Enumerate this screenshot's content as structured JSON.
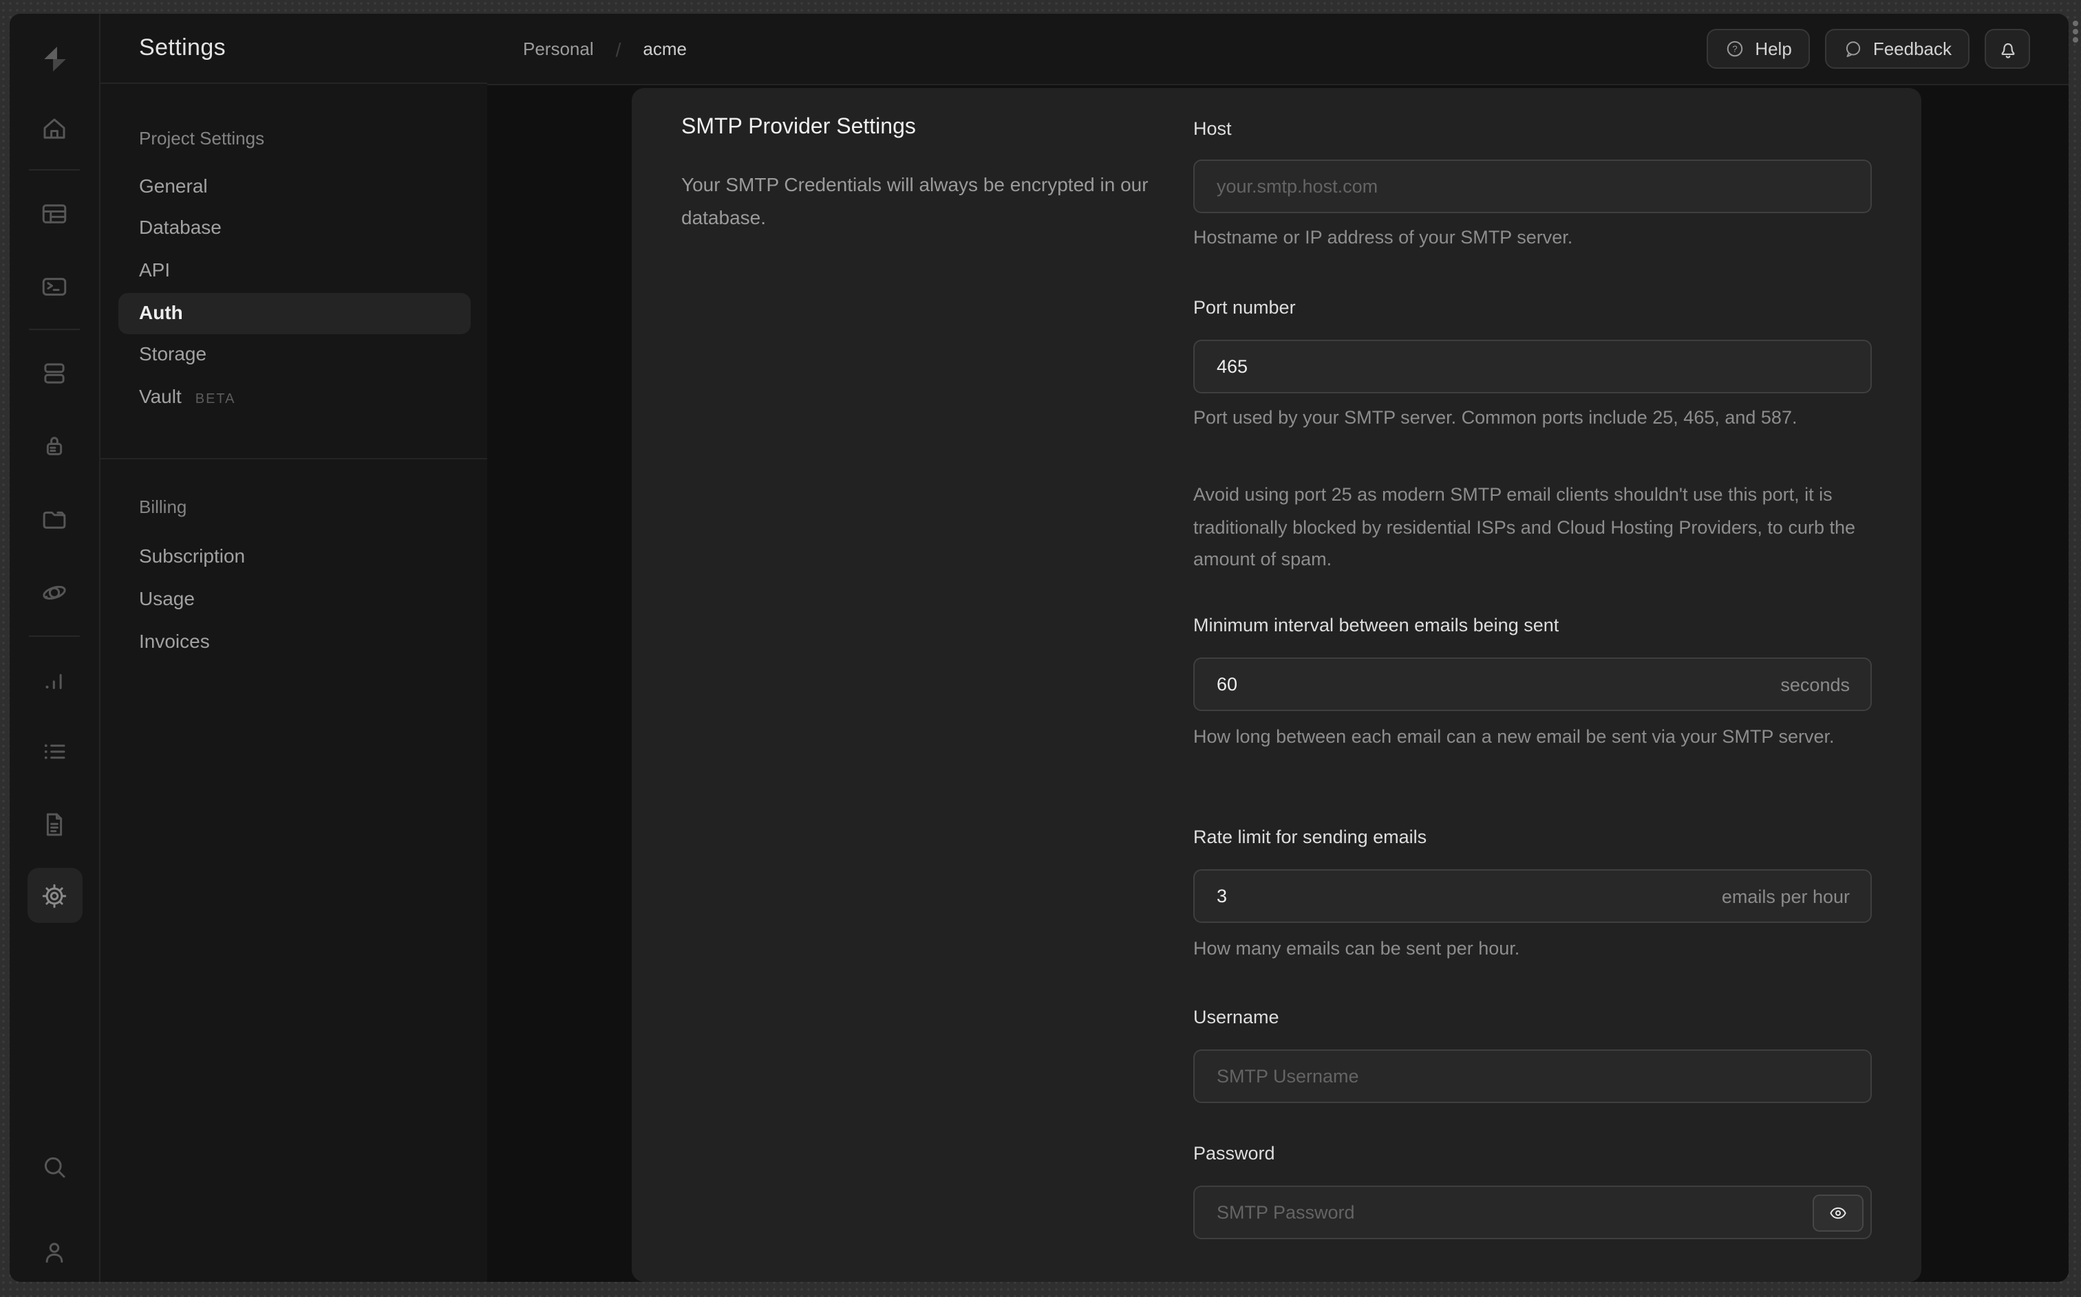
{
  "frame": {
    "scrollbar_dots": 3
  },
  "rail": {
    "logo": "supabase-logo",
    "items": [
      "home",
      "table-editor",
      "sql-editor",
      "database",
      "authentication",
      "storage",
      "edge-functions",
      "reports",
      "logs",
      "api-docs",
      "project-settings",
      "search",
      "account"
    ]
  },
  "sidebar": {
    "title": "Settings",
    "sections": [
      {
        "label": "Project Settings",
        "items": [
          {
            "label": "General"
          },
          {
            "label": "Database"
          },
          {
            "label": "API"
          },
          {
            "label": "Auth",
            "active": true
          },
          {
            "label": "Storage"
          },
          {
            "label": "Vault",
            "badge": "BETA"
          }
        ]
      },
      {
        "label": "Billing",
        "items": [
          {
            "label": "Subscription"
          },
          {
            "label": "Usage"
          },
          {
            "label": "Invoices"
          }
        ]
      }
    ]
  },
  "header": {
    "breadcrumb": {
      "org": "Personal",
      "separator": "/",
      "project": "acme"
    },
    "help_label": "Help",
    "feedback_label": "Feedback"
  },
  "panel": {
    "title": "SMTP Provider Settings",
    "description": "Your SMTP Credentials will always be encrypted in our database.",
    "fields": {
      "host": {
        "label": "Host",
        "placeholder": "your.smtp.host.com",
        "help": "Hostname or IP address of your SMTP server."
      },
      "port": {
        "label": "Port number",
        "value": "465",
        "help": "Port used by your SMTP server. Common ports include 25, 465, and 587.",
        "note": "Avoid using port 25 as modern SMTP email clients shouldn't use this port, it is traditionally blocked by residential ISPs and Cloud Hosting Providers, to curb the amount of spam."
      },
      "interval": {
        "label": "Minimum interval between emails being sent",
        "value": "60",
        "suffix": "seconds",
        "help": "How long between each email can a new email be sent via your SMTP server."
      },
      "rate": {
        "label": "Rate limit for sending emails",
        "value": "3",
        "suffix": "emails per hour",
        "help": "How many emails can be sent per hour."
      },
      "username": {
        "label": "Username",
        "placeholder": "SMTP Username"
      },
      "password": {
        "label": "Password",
        "placeholder": "SMTP Password"
      }
    }
  },
  "colors": {
    "frame_bg": "#2f2f2f",
    "app_bg": "#161616",
    "page_bg": "#101010",
    "card_bg": "#222222",
    "input_bg": "#282828",
    "input_border": "#3f3f3f",
    "text_primary": "#ededed",
    "text_secondary": "#8d8d8d",
    "border": "#242424"
  }
}
